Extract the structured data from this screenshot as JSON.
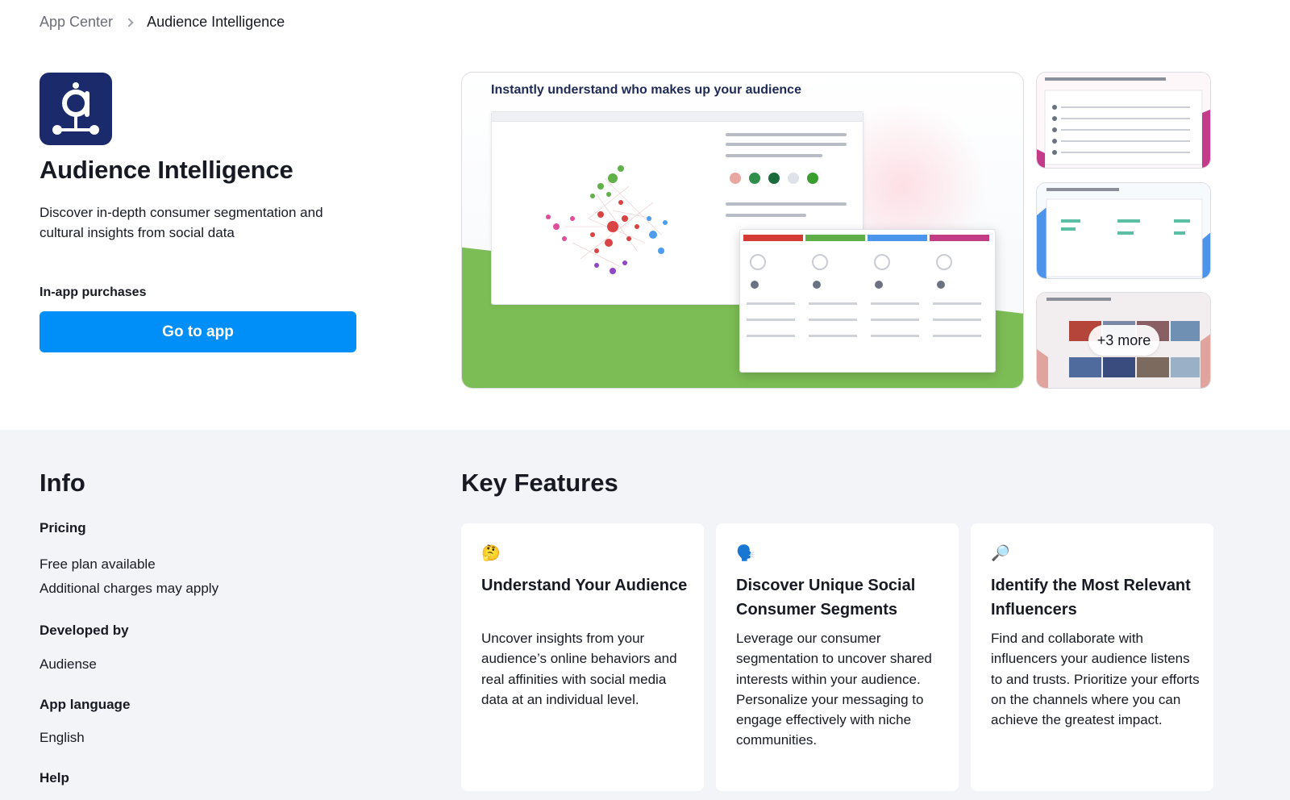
{
  "breadcrumb": {
    "root": "App Center",
    "current": "Audience Intelligence"
  },
  "app": {
    "logo_icon": "audiense-logo-icon",
    "brand_color": "#1b2a6b",
    "title": "Audience Intelligence",
    "description": "Discover in-depth consumer segmentation and cultural insights from social data",
    "purchases_label": "In-app purchases",
    "cta_label": "Go to app",
    "cta_color": "#008ff8"
  },
  "gallery": {
    "hero_caption": "Instantly understand who makes up your audience",
    "more_label": "+3 more"
  },
  "info": {
    "heading": "Info",
    "pricing_label": "Pricing",
    "pricing_values": [
      "Free plan available",
      "Additional charges may apply"
    ],
    "developer_label": "Developed by",
    "developer_value": "Audiense",
    "language_label": "App language",
    "language_value": "English",
    "help_label": "Help"
  },
  "features": {
    "heading": "Key Features",
    "cards": [
      {
        "emoji": "🤔",
        "title": "Understand Your Audience",
        "text": "Uncover insights from your audience’s online behaviors and real affinities with social media data at an individual level."
      },
      {
        "emoji": "🗣️",
        "title": "Discover Unique Social Consumer Segments",
        "text": "Leverage our consumer segmentation to uncover shared interests within your audience. Personalize your messaging to engage effectively with niche communities."
      },
      {
        "emoji": "🔎",
        "title": "Identify the Most Relevant Influencers",
        "text": "Find and collaborate with influencers your audience listens to and trusts. Prioritize your efforts on the channels where you can achieve the greatest impact."
      }
    ]
  }
}
